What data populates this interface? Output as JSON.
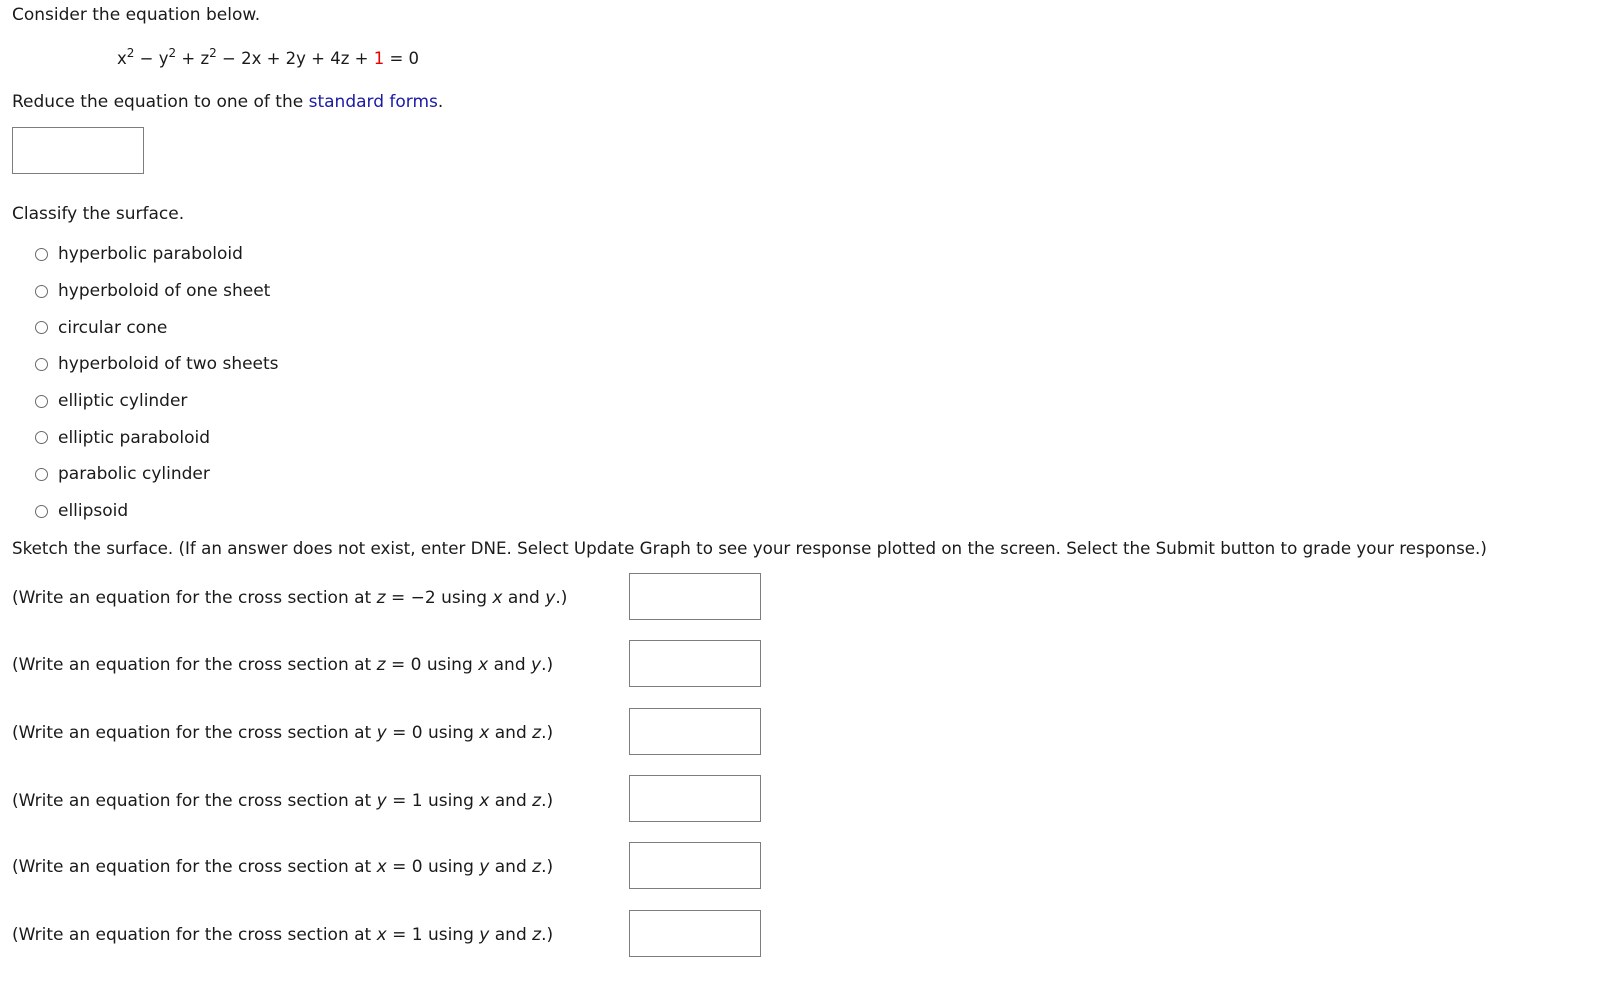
{
  "intro_text": "Consider the equation below.",
  "equation": {
    "t1_base": "x",
    "t1_exp": "2",
    "op1": " − ",
    "t2_base": "y",
    "t2_exp": "2",
    "op2": " + ",
    "t3_base": "z",
    "t3_exp": "2",
    "rest": " − 2x + 2y + 4z + ",
    "highlight": "1",
    "tail": " = 0",
    "highlight_color": "#e60000"
  },
  "reduce": {
    "prefix": "Reduce the equation to one of the ",
    "link": "standard forms",
    "suffix": ".",
    "answer_value": ""
  },
  "classify": {
    "prompt": "Classify the surface.",
    "options": [
      "hyperbolic paraboloid",
      "hyperboloid of one sheet",
      "circular cone",
      "hyperboloid of two sheets",
      "elliptic cylinder",
      "elliptic paraboloid",
      "parabolic cylinder",
      "ellipsoid"
    ],
    "selected": null
  },
  "sketch_text": "Sketch the surface. (If an answer does not exist, enter DNE. Select Update Graph to see your response plotted on the screen. Select the Submit button to grade your response.)",
  "cross_sections": [
    {
      "pre": "(Write an equation for the cross section at ",
      "var": "z",
      "eq": " = −2 using ",
      "v1": "x",
      "mid": " and ",
      "v2": "y",
      "post": ".)",
      "value": ""
    },
    {
      "pre": "(Write an equation for the cross section at ",
      "var": "z",
      "eq": " = 0 using ",
      "v1": "x",
      "mid": " and ",
      "v2": "y",
      "post": ".)",
      "value": ""
    },
    {
      "pre": "(Write an equation for the cross section at ",
      "var": "y",
      "eq": " = 0 using ",
      "v1": "x",
      "mid": " and ",
      "v2": "z",
      "post": ".)",
      "value": ""
    },
    {
      "pre": "(Write an equation for the cross section at ",
      "var": "y",
      "eq": " = 1 using ",
      "v1": "x",
      "mid": " and ",
      "v2": "z",
      "post": ".)",
      "value": ""
    },
    {
      "pre": "(Write an equation for the cross section at ",
      "var": "x",
      "eq": " = 0 using ",
      "v1": "y",
      "mid": " and ",
      "v2": "z",
      "post": ".)",
      "value": ""
    },
    {
      "pre": "(Write an equation for the cross section at ",
      "var": "x",
      "eq": " = 1 using ",
      "v1": "y",
      "mid": " and ",
      "v2": "z",
      "post": ".)",
      "value": ""
    }
  ]
}
